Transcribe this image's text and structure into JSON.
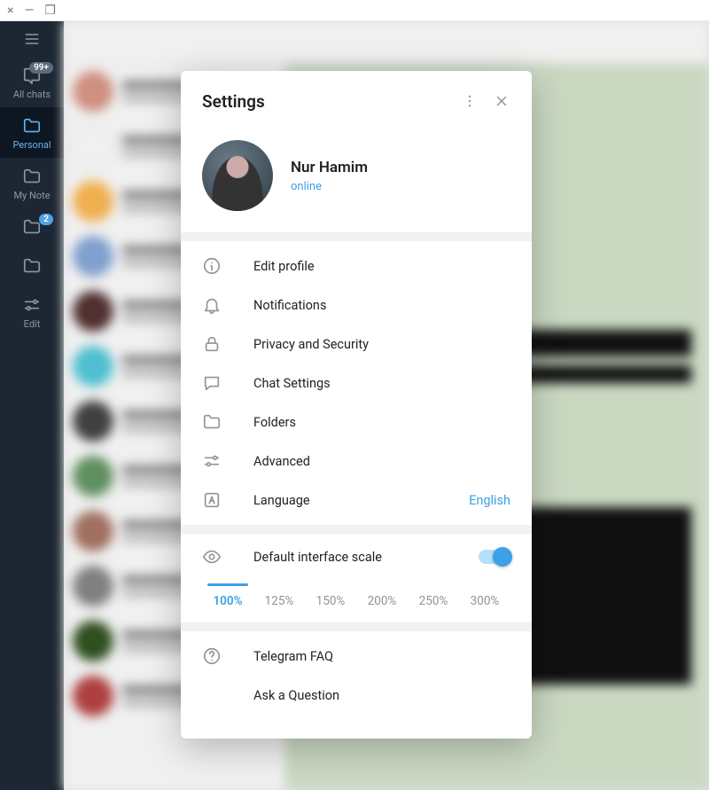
{
  "titlebar": {
    "close": "×",
    "min": "—",
    "max": "❐"
  },
  "sidebar": {
    "items": [
      {
        "label": "All chats",
        "badge": "99+"
      },
      {
        "label": "Personal"
      },
      {
        "label": "My Note"
      },
      {
        "label": "",
        "badge": "2"
      },
      {
        "label": ""
      },
      {
        "label": "Edit"
      }
    ]
  },
  "settings": {
    "title": "Settings",
    "profile": {
      "name": "Nur Hamim",
      "status": "online"
    },
    "menu": {
      "edit_profile": "Edit profile",
      "notifications": "Notifications",
      "privacy": "Privacy and Security",
      "chat_settings": "Chat Settings",
      "folders": "Folders",
      "advanced": "Advanced",
      "language": "Language",
      "language_value": "English"
    },
    "scale": {
      "label": "Default interface scale",
      "options": [
        "100%",
        "125%",
        "150%",
        "200%",
        "250%",
        "300%"
      ],
      "active_index": 0
    },
    "help": {
      "faq": "Telegram FAQ",
      "ask": "Ask a Question"
    }
  }
}
